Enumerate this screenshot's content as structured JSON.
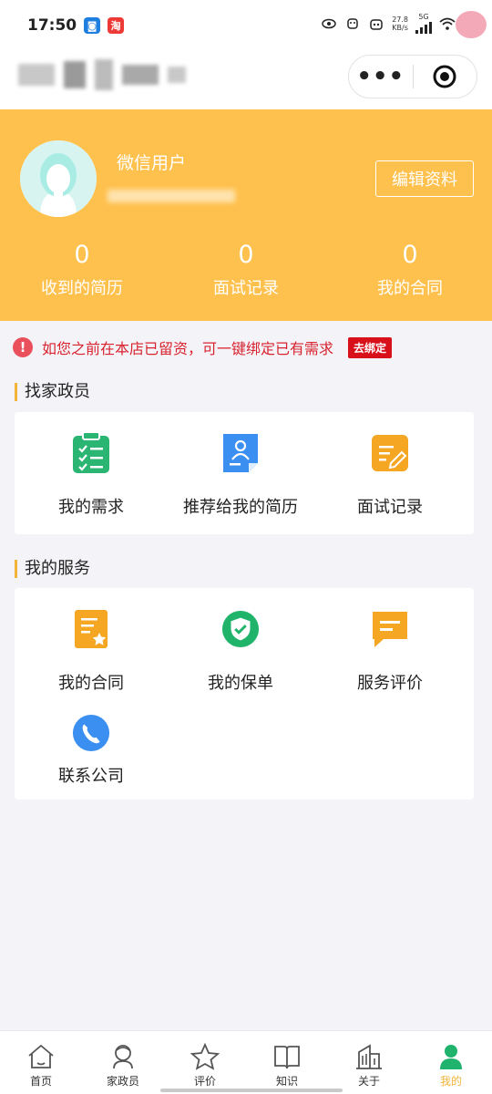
{
  "status_bar": {
    "time": "17:50",
    "app_badges": [
      {
        "icon": "qq-browser-icon",
        "glyph": "◙",
        "color": "#1f7fe0"
      },
      {
        "icon": "taobao-icon",
        "glyph": "淘",
        "color": "#ee3a36"
      }
    ],
    "speed_value": "27.8",
    "speed_unit": "KB/s",
    "network": "5G"
  },
  "header": {
    "more_icon": "more-dots-icon",
    "close_icon": "target-icon"
  },
  "profile": {
    "user_name": "微信用户",
    "edit_label": "编辑资料",
    "stats": [
      {
        "value": "0",
        "label": "收到的简历"
      },
      {
        "value": "0",
        "label": "面试记录"
      },
      {
        "value": "0",
        "label": "我的合同"
      }
    ]
  },
  "notice": {
    "icon": "!",
    "text": "如您之前在本店已留资，可一键绑定已有需求",
    "bind_label": "去绑定"
  },
  "find_section": {
    "title": "找家政员",
    "items": [
      {
        "label": "我的需求",
        "icon": "checklist-icon",
        "color": "#2bb573"
      },
      {
        "label": "推荐给我的简历",
        "icon": "resume-icon",
        "color": "#3b8ff0"
      },
      {
        "label": "面试记录",
        "icon": "edit-note-icon",
        "color": "#f5a623"
      }
    ]
  },
  "service_section": {
    "title": "我的服务",
    "items": [
      {
        "label": "我的合同",
        "icon": "contract-icon",
        "color": "#f5a623"
      },
      {
        "label": "我的保单",
        "icon": "shield-check-icon",
        "color": "#20b46a"
      },
      {
        "label": "服务评价",
        "icon": "comment-icon",
        "color": "#f5a623"
      },
      {
        "label": "联系公司",
        "icon": "phone-icon",
        "color": "#3b8ff0"
      }
    ]
  },
  "tabbar": {
    "tabs": [
      {
        "label": "首页",
        "icon": "home-icon"
      },
      {
        "label": "家政员",
        "icon": "housekeeper-icon"
      },
      {
        "label": "评价",
        "icon": "star-icon"
      },
      {
        "label": "知识",
        "icon": "book-icon"
      },
      {
        "label": "关于",
        "icon": "building-icon"
      },
      {
        "label": "我的",
        "icon": "user-icon",
        "active": true
      }
    ],
    "active_color": "#f2b53a"
  },
  "colors": {
    "profile_bg": "#ffc14d",
    "notice_red": "#d8232f"
  }
}
